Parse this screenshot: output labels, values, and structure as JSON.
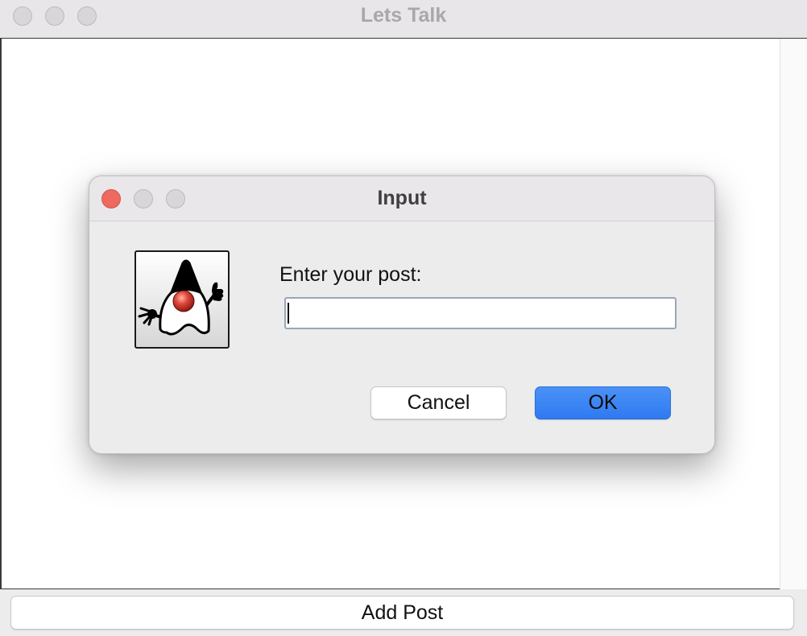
{
  "window": {
    "title": "Lets Talk"
  },
  "bottom_bar": {
    "add_post_label": "Add Post"
  },
  "dialog": {
    "title": "Input",
    "prompt": "Enter your post:",
    "input_value": "",
    "cancel_label": "Cancel",
    "ok_label": "OK",
    "icon": "java-duke-icon"
  },
  "colors": {
    "close_button": "#ee6a5f",
    "ok_button": "#3a84f4",
    "window_bg": "#ececec"
  }
}
